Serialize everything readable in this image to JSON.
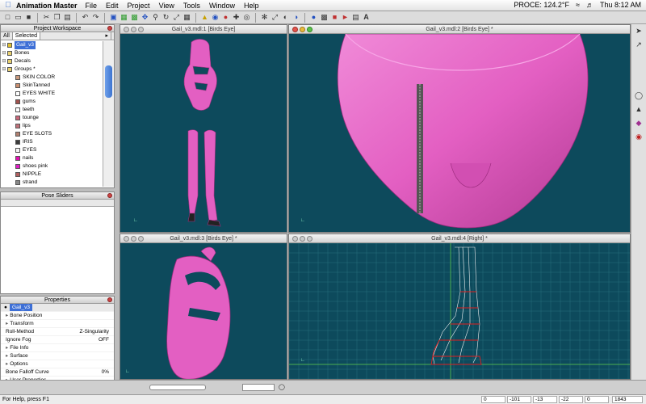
{
  "menubar": {
    "app_name": "Animation Master",
    "items": [
      "File",
      "Edit",
      "Project",
      "View",
      "Tools",
      "Window",
      "Help"
    ],
    "status_right": "PROCE: 124.2°F",
    "clock": "Thu 8:12 AM"
  },
  "workspace": {
    "title": "Project Workspace",
    "tab_all": "All",
    "tab_selected": "Selected",
    "tree": [
      {
        "label": "Gail_v3",
        "highlight": true,
        "icon": "model-icon"
      },
      {
        "label": "Bones",
        "icon": "folder-icon"
      },
      {
        "label": "Decals",
        "icon": "folder-icon"
      },
      {
        "label": "Groups *",
        "icon": "folder-icon"
      },
      {
        "label": "SKIN COLOR",
        "color": "#c99a7e"
      },
      {
        "label": "SkinTanned",
        "color": "#c98f70"
      },
      {
        "label": "EYES WHITE",
        "color": "#ffffff"
      },
      {
        "label": "gums",
        "color": "#a0524d"
      },
      {
        "label": "teeth",
        "color": "#ffffff"
      },
      {
        "label": "tounge",
        "color": "#c9677a"
      },
      {
        "label": "lips",
        "color": "#c0727a"
      },
      {
        "label": "EYE SLOTS",
        "color": "#b08070"
      },
      {
        "label": "IRIS",
        "color": "#3a3a3a"
      },
      {
        "label": "EYES",
        "color": "#f4f4f4"
      },
      {
        "label": "nails",
        "color": "#e00fb0"
      },
      {
        "label": "shoes pink",
        "color": "#e11ec7"
      },
      {
        "label": "NIPPLE",
        "color": "#b06060"
      },
      {
        "label": "strand",
        "color": "#888888"
      }
    ]
  },
  "pose": {
    "title": "Pose Sliders"
  },
  "properties": {
    "title": "Properties",
    "object": "Gail_v3",
    "rows": [
      {
        "label": "Bone Position",
        "value": "",
        "expand": true
      },
      {
        "label": "Transform",
        "value": "",
        "expand": true
      },
      {
        "label": "Roll-Method",
        "value": "Z-Singularity",
        "expand": false
      },
      {
        "label": "Ignore Fog",
        "value": "OFF",
        "expand": false
      },
      {
        "label": "File Info",
        "value": "",
        "expand": true
      },
      {
        "label": "Surface",
        "value": "",
        "expand": true
      },
      {
        "label": "Options",
        "value": "",
        "expand": true
      },
      {
        "label": "Bone Falloff Curve",
        "value": "0%",
        "expand": false
      },
      {
        "label": "User Properties",
        "value": "",
        "expand": true
      }
    ]
  },
  "viewports": {
    "v1": "Gail_v3.mdl:1 [Birds Eye]",
    "v2": "Gail_v3.mdl:2 [Birds Eye] *",
    "v3": "Gail_v3.mdl:3 [Birds Eye] *",
    "v4": "Gail_v3.mdl:4 [Right] *"
  },
  "colors": {
    "viewport_bg": "#0d4a5c",
    "model_pink": "#e35fc2",
    "spline_red": "#e02020",
    "grid": "#2f7a86"
  },
  "statusbar": {
    "help": "For Help, press F1",
    "fields": [
      "0",
      "-101",
      "-13",
      "-22",
      "0",
      "1843"
    ]
  }
}
